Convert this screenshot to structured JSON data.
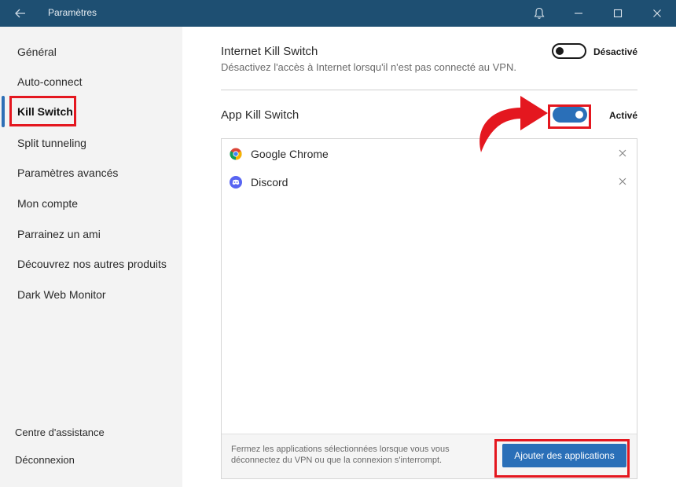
{
  "window": {
    "title": "Paramètres",
    "icons": [
      "back-arrow-icon",
      "bell-icon",
      "minimize-icon",
      "maximize-icon",
      "close-icon"
    ]
  },
  "sidebar": {
    "items": [
      {
        "label": "Général"
      },
      {
        "label": "Auto-connect"
      },
      {
        "label": "Kill Switch",
        "active": true
      },
      {
        "label": "Split tunneling"
      },
      {
        "label": "Paramètres avancés"
      },
      {
        "label": "Mon compte"
      },
      {
        "label": "Parrainez un ami"
      },
      {
        "label": "Découvrez nos autres produits"
      },
      {
        "label": "Dark Web Monitor"
      }
    ],
    "bottom": [
      {
        "label": "Centre d'assistance"
      },
      {
        "label": "Déconnexion"
      }
    ]
  },
  "internet_kill_switch": {
    "title": "Internet Kill Switch",
    "description": "Désactivez l'accès à Internet lorsqu'il n'est pas connecté au VPN.",
    "state_label": "Désactivé",
    "enabled": false
  },
  "app_kill_switch": {
    "title": "App Kill Switch",
    "state_label": "Activé",
    "enabled": true,
    "apps": [
      {
        "name": "Google Chrome",
        "icon": "chrome-icon"
      },
      {
        "name": "Discord",
        "icon": "discord-icon"
      }
    ],
    "footer_note": "Fermez les applications sélectionnées lorsque vous vous déconnectez du VPN ou que la connexion s'interrompt.",
    "add_button_label": "Ajouter des applications"
  },
  "colors": {
    "titlebar": "#1e4f72",
    "accent": "#2a6fb8",
    "highlight": "#e4171f"
  }
}
